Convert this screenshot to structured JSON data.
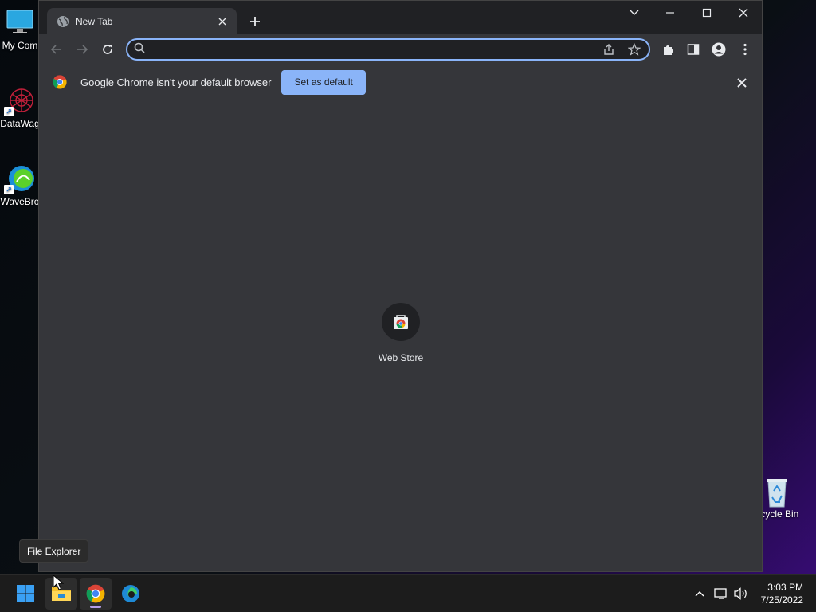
{
  "desktop": {
    "icons": [
      {
        "label": "My Com"
      },
      {
        "label": "DataWag"
      },
      {
        "label": "WaveBro"
      },
      {
        "label": "ecycle Bin"
      }
    ]
  },
  "browser": {
    "tab": {
      "title": "New Tab"
    },
    "omnibox": {
      "value": "",
      "placeholder": ""
    },
    "infobar": {
      "message": "Google Chrome isn't your default browser",
      "button_label": "Set as default"
    },
    "shortcuts": [
      {
        "label": "Web Store"
      }
    ]
  },
  "tooltip": {
    "text": "File Explorer"
  },
  "taskbar": {
    "clock": {
      "time": "3:03 PM",
      "date": "7/25/2022"
    }
  },
  "colors": {
    "accent": "#8ab4f8",
    "window_bg": "#35363a",
    "tabstrip_bg": "#202124",
    "taskbar_bg": "#1c1c1c"
  }
}
